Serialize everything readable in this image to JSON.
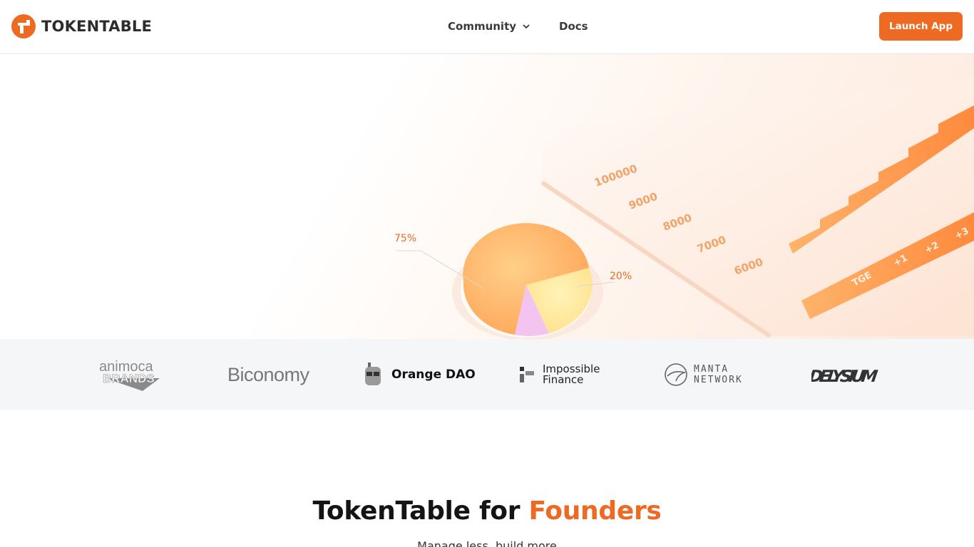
{
  "header": {
    "brand": "TOKENTABLE",
    "nav": [
      {
        "label": "Community",
        "has_dropdown": true
      },
      {
        "label": "Docs",
        "has_dropdown": false
      }
    ],
    "cta_label": "Launch App"
  },
  "hero": {
    "pie_labels": [
      "75%",
      "20%"
    ],
    "axis_values": [
      "100000",
      "9000",
      "8000",
      "7000",
      "6000"
    ],
    "period_labels": [
      "TGE",
      "+1",
      "+2",
      "+3"
    ]
  },
  "partners": [
    {
      "name": "animoca",
      "name2": "BRANDS",
      "icon": "animoca-brands-logo"
    },
    {
      "name": "Biconomy",
      "icon": "biconomy-logo"
    },
    {
      "name": "Orange DAO",
      "icon": "orange-dao-logo"
    },
    {
      "name": "Impossible",
      "name2": "Finance",
      "icon": "impossible-finance-logo"
    },
    {
      "name": "MANTA",
      "name2": "NETWORK",
      "icon": "manta-network-logo"
    },
    {
      "name": "DELYSIUM",
      "icon": "delysium-logo"
    }
  ],
  "section": {
    "title_prefix": "TokenTable for ",
    "title_accent": "Founders",
    "subtitle": "Manage less, build more"
  },
  "colors": {
    "accent": "#ee6a22",
    "strip": "#f5f6f8"
  }
}
